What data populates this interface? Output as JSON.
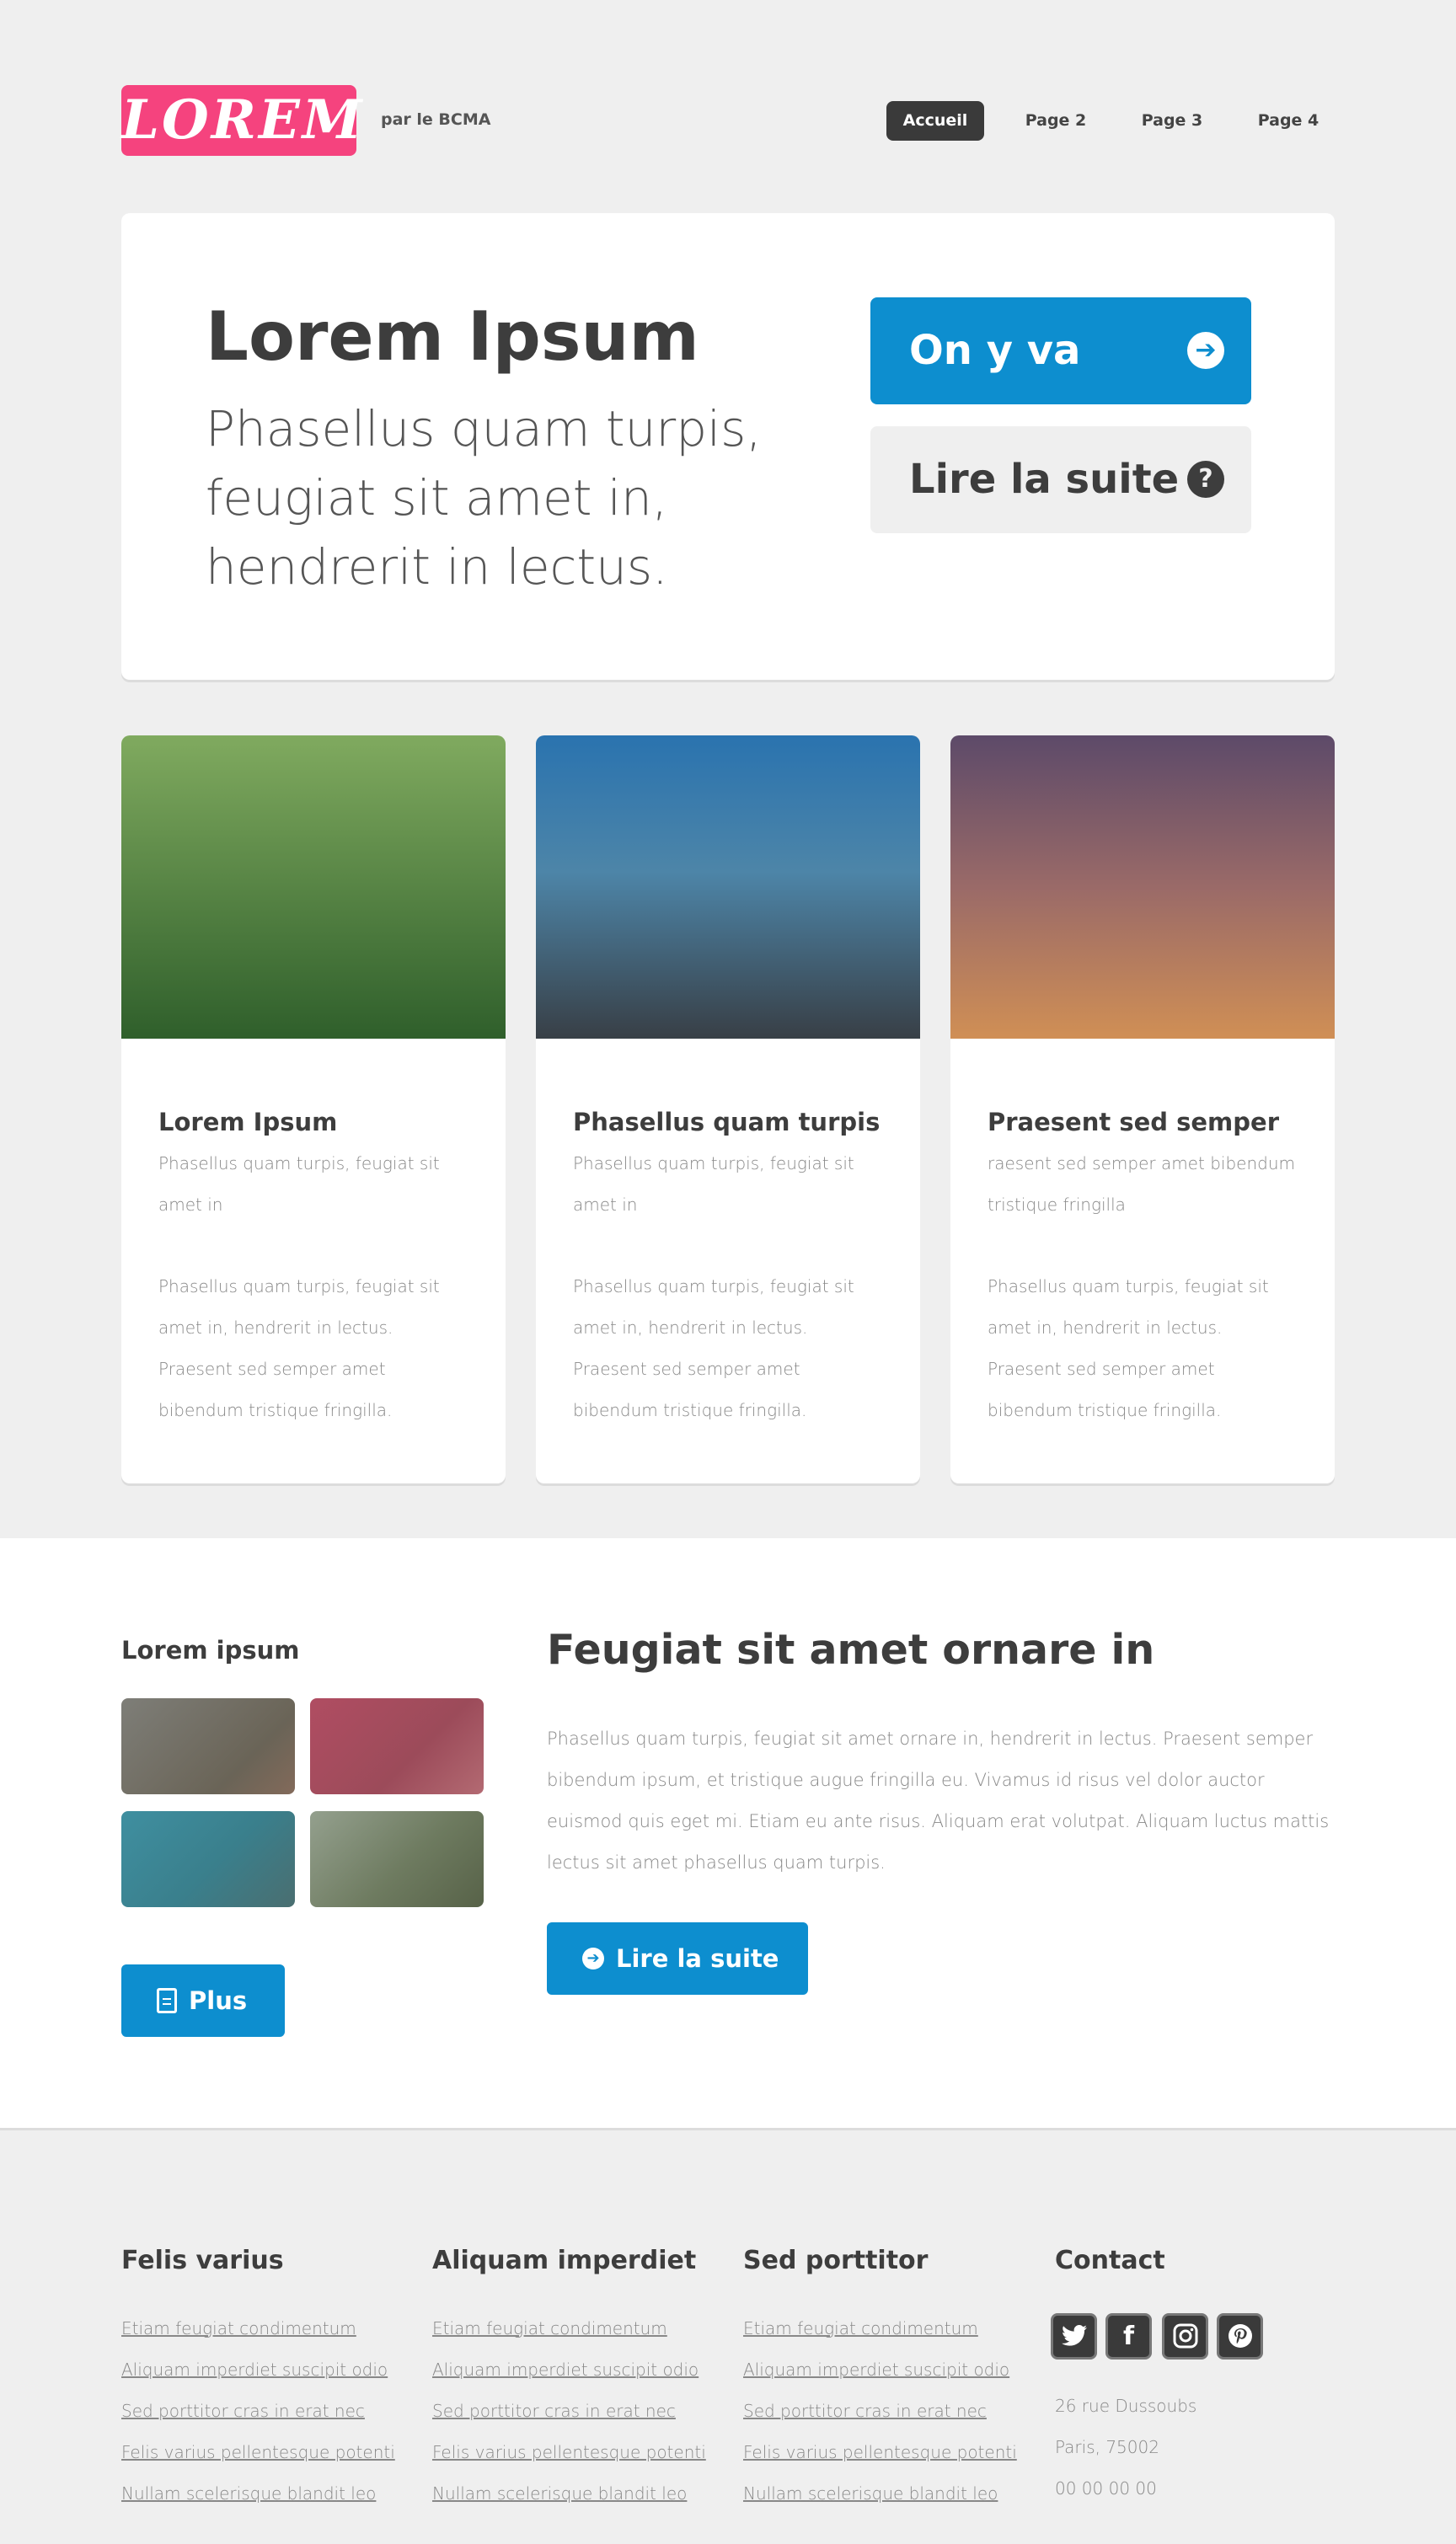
{
  "header": {
    "logo": "LOREM",
    "byline": "par le BCMA",
    "nav": [
      "Accueil",
      "Page 2",
      "Page 3",
      "Page 4"
    ]
  },
  "hero": {
    "title": "Lorem Ipsum",
    "subtitle_lines": [
      "Phasellus quam turpis,",
      "feugiat sit amet in,",
      "hendrerit in lectus."
    ],
    "primary_button": "On y va",
    "secondary_button": "Lire la suite"
  },
  "cards": [
    {
      "title": "Lorem Ipsum",
      "intro": "Phasellus quam turpis, feugiat sit amet in",
      "body": "Phasellus quam turpis, feugiat sit amet in, hendrerit in lectus. Praesent sed semper amet bibendum tristique fringilla.",
      "colors": [
        "#7fa85d",
        "#2f5f2b"
      ]
    },
    {
      "title": "Phasellus quam turpis",
      "intro": "Phasellus quam turpis, feugiat sit amet in",
      "body": "Phasellus quam turpis, feugiat sit amet in, hendrerit in lectus. Praesent sed semper amet bibendum tristique fringilla.",
      "colors": [
        "#2c73ae",
        "#3a4048"
      ]
    },
    {
      "title": "Praesent sed semper",
      "intro": "raesent sed semper amet bibendum tristique fringilla",
      "body": "Phasellus quam turpis, feugiat sit amet in, hendrerit in lectus. Praesent sed semper amet bibendum tristique fringilla.",
      "colors": [
        "#5e4b68",
        "#cf8f55"
      ]
    }
  ],
  "band": {
    "side_title": "Lorem ipsum",
    "thumb_colors": [
      "#6d6b65",
      "#a24d5e",
      "#3f8b99",
      "#6f7b62"
    ],
    "more_button": "Plus",
    "title": "Feugiat sit amet ornare in",
    "text": "Phasellus quam turpis, feugiat sit amet ornare in, hendrerit in lectus. Praesent semper bibendum ipsum, et tristique augue fringilla eu. Vivamus id risus vel dolor auctor euismod quis eget mi. Etiam eu ante risus. Aliquam erat volutpat. Aliquam luctus mattis lectus sit amet phasellus quam turpis.",
    "read_more_button": "Lire la suite"
  },
  "footer": {
    "columns": [
      {
        "title": "Felis varius",
        "links": [
          "Etiam feugiat condimentum",
          "Aliquam imperdiet suscipit odio",
          "Sed porttitor cras in erat nec",
          "Felis varius pellentesque potenti",
          "Nullam scelerisque blandit leo"
        ]
      },
      {
        "title": "Aliquam imperdiet",
        "links": [
          "Etiam feugiat condimentum",
          "Aliquam imperdiet suscipit odio",
          "Sed porttitor cras in erat nec",
          "Felis varius pellentesque potenti",
          "Nullam scelerisque blandit leo"
        ]
      },
      {
        "title": "Sed porttitor",
        "links": [
          "Etiam feugiat condimentum",
          "Aliquam imperdiet suscipit odio",
          "Sed porttitor cras in erat nec",
          "Felis varius pellentesque potenti",
          "Nullam scelerisque blandit leo"
        ]
      }
    ],
    "contact": {
      "title": "Contact",
      "social_icons": [
        "twitter-icon",
        "facebook-icon",
        "instagram-icon",
        "pinterest-icon"
      ],
      "lines": [
        "26 rue Dussoubs",
        "Paris, 75002",
        "00 00 00 00"
      ]
    }
  },
  "colors": {
    "brand": "#f5437e",
    "accent": "#0d8ecf",
    "dark": "#3a3a3a"
  }
}
